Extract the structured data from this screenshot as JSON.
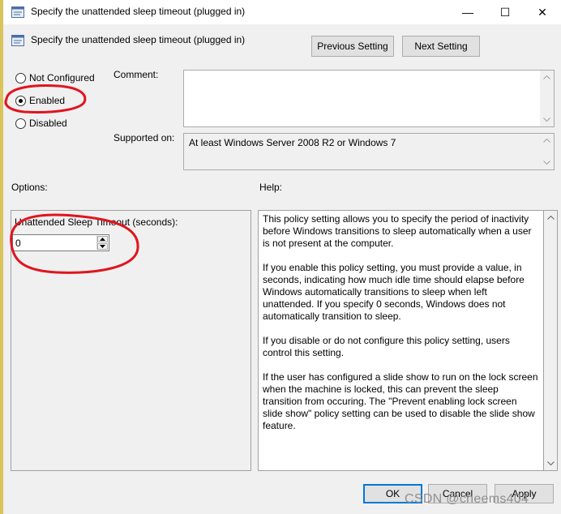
{
  "window": {
    "title": "Specify the unattended sleep timeout (plugged in)",
    "minimize_glyph": "—",
    "maximize_glyph": "☐",
    "close_glyph": "✕"
  },
  "header": {
    "title": "Specify the unattended sleep timeout (plugged in)",
    "prev_button": "Previous Setting",
    "next_button": "Next Setting"
  },
  "state": {
    "options": [
      {
        "label": "Not Configured",
        "selected": false
      },
      {
        "label": "Enabled",
        "selected": true
      },
      {
        "label": "Disabled",
        "selected": false
      }
    ]
  },
  "comment": {
    "label": "Comment:",
    "value": ""
  },
  "supported": {
    "label": "Supported on:",
    "value": "At least Windows Server 2008 R2 or Windows 7"
  },
  "options_section": {
    "label": "Options:",
    "field_label": "Unattended Sleep Timeout (seconds):",
    "field_value": "0"
  },
  "help_section": {
    "label": "Help:",
    "paragraphs": [
      "This policy setting allows you to specify the period of inactivity before Windows transitions to sleep automatically when a user is not present at the computer.",
      "If you enable this policy setting, you must provide a value, in seconds, indicating how much idle time should elapse before Windows automatically transitions to sleep when left unattended.  If you specify 0 seconds, Windows does not automatically transition to sleep.",
      "If you disable or do not configure this policy setting, users control this setting.",
      "If the user has configured a slide show to run on the lock screen when the machine is locked, this can prevent the sleep transition from occuring.  The \"Prevent enabling lock screen slide show\" policy setting can be used to disable the slide show feature."
    ]
  },
  "footer": {
    "ok": "OK",
    "cancel": "Cancel",
    "apply": "Apply"
  },
  "watermark": "CSDN @cheems404",
  "icons": {
    "title": "policy-setting-icon",
    "header": "policy-setting-icon"
  },
  "colors": {
    "annotation": "#e0141e",
    "focus": "#0078d7"
  }
}
